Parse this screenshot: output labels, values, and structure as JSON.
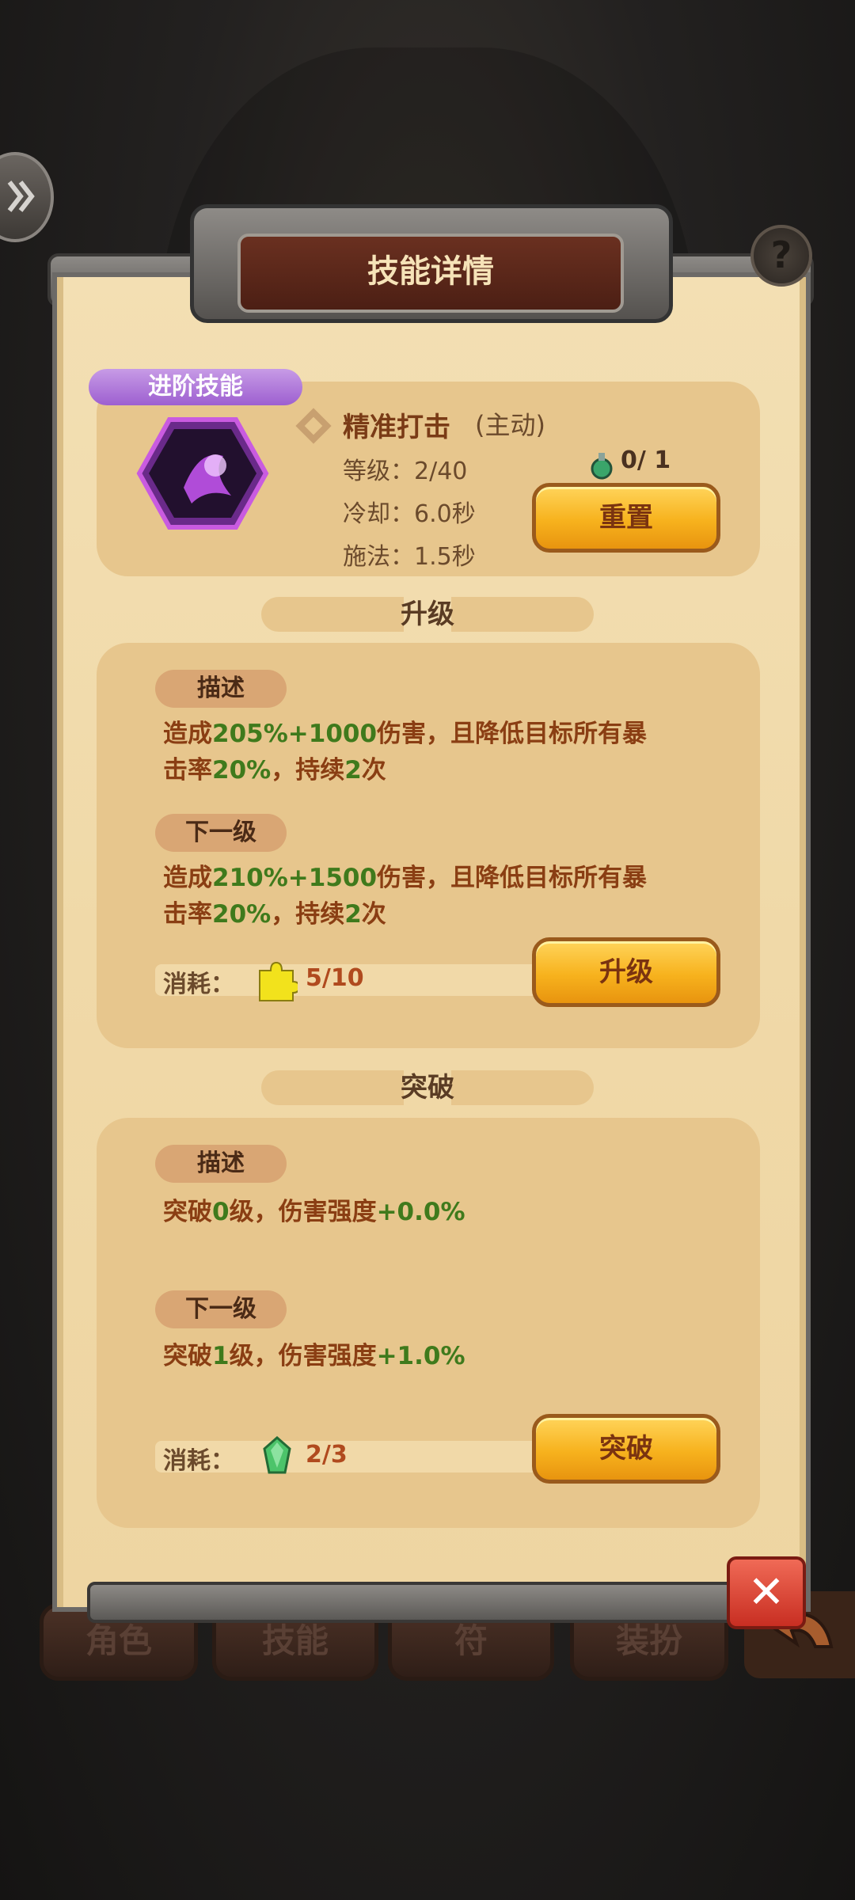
{
  "panel": {
    "title": "技能详情"
  },
  "skill": {
    "badge": "进阶技能",
    "name": "精准打击",
    "mode": "(主动)",
    "level": "等级：2/40",
    "cooldown": "冷却：6.0秒",
    "cast": "施法：1.5秒",
    "potion_count": "0/ 1",
    "reset_label": "重置"
  },
  "upgrade": {
    "section_title": "升级",
    "desc_tag": "描述",
    "desc": [
      "造成",
      "205%+1000",
      "伤害，且降低目标所有暴",
      "击率",
      "20%",
      "，持续",
      "2",
      "次"
    ],
    "next_tag": "下一级",
    "next": [
      "造成",
      "210%+1500",
      "伤害，且降低目标所有暴",
      "击率",
      "20%",
      "，持续",
      "2",
      "次"
    ],
    "cost_label": "消耗：",
    "cost_value": "5/10",
    "button_label": "升级"
  },
  "breakthrough": {
    "section_title": "突破",
    "desc_tag": "描述",
    "desc": [
      "突破",
      "0",
      "级，伤害强度",
      "+0.0%"
    ],
    "next_tag": "下一级",
    "next": [
      "突破",
      "1",
      "级，伤害强度",
      "+1.0%"
    ],
    "cost_label": "消耗：",
    "cost_value": "2/3",
    "button_label": "突破"
  },
  "tabs": [
    "角色",
    "技能",
    "符",
    "装扮"
  ],
  "icons": {
    "side": "double-chevron-icon",
    "help": "question-icon",
    "close": "close-icon",
    "back": "back-arrow-icon",
    "puzzle": "puzzle-piece-icon",
    "crystal": "green-crystal-icon",
    "potion": "potion-icon",
    "skill": "skill-portrait-icon"
  },
  "colors": {
    "accent": "#f7b21d",
    "value_green": "#3f7a1c",
    "text_brown": "#8a3e13",
    "badge_purple": "#9d5fd0"
  }
}
